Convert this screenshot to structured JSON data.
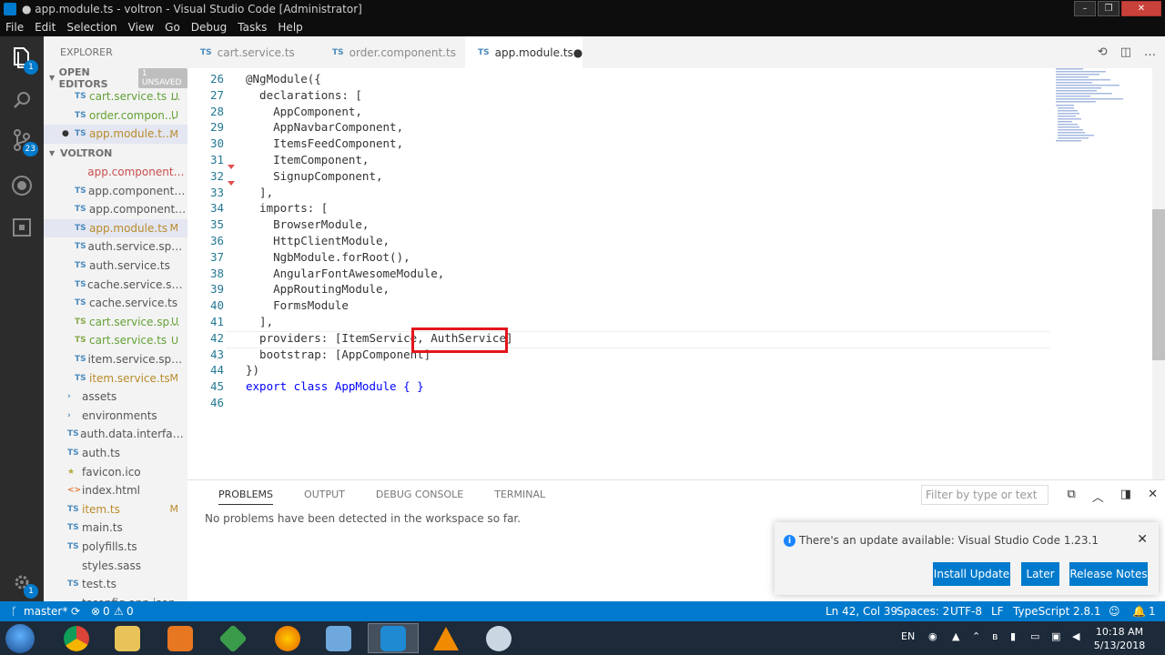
{
  "window": {
    "title": "● app.module.ts - voltron - Visual Studio Code [Administrator]"
  },
  "menu": [
    "File",
    "Edit",
    "Selection",
    "View",
    "Go",
    "Debug",
    "Tasks",
    "Help"
  ],
  "activity": {
    "scm_badge": "23",
    "explorer_badge": "1",
    "settings_badge": "1"
  },
  "sidebar": {
    "title": "EXPLORER",
    "open_editors": {
      "label": "OPEN EDITORS",
      "unsaved": "1 UNSAVED",
      "items": [
        {
          "icon": "TS",
          "name": "cart.service.ts ...",
          "status": "U"
        },
        {
          "icon": "TS",
          "name": "order.compon...",
          "status": "U"
        },
        {
          "icon": "TS",
          "name": "app.module.t...",
          "status": "M"
        }
      ]
    },
    "project": {
      "label": "VOLTRON",
      "items": [
        {
          "icon": "",
          "name": "app.component.sa...",
          "status": ""
        },
        {
          "icon": "TS",
          "name": "app.component.s...",
          "status": ""
        },
        {
          "icon": "TS",
          "name": "app.component.ts",
          "status": ""
        },
        {
          "icon": "TS",
          "name": "app.module.ts",
          "status": "M"
        },
        {
          "icon": "TS",
          "name": "auth.service.spec.ts",
          "status": ""
        },
        {
          "icon": "TS",
          "name": "auth.service.ts",
          "status": ""
        },
        {
          "icon": "TS",
          "name": "cache.service.spec...",
          "status": ""
        },
        {
          "icon": "TS",
          "name": "cache.service.ts",
          "status": ""
        },
        {
          "icon": "TS",
          "name": "cart.service.sp...",
          "status": "U"
        },
        {
          "icon": "TS",
          "name": "cart.service.ts",
          "status": "U"
        },
        {
          "icon": "TS",
          "name": "item.service.spec.ts",
          "status": ""
        },
        {
          "icon": "TS",
          "name": "item.service.ts",
          "status": "M"
        },
        {
          "icon": "›",
          "name": "assets",
          "status": ""
        },
        {
          "icon": "›",
          "name": "environments",
          "status": ""
        },
        {
          "icon": "TS",
          "name": "auth.data.interfaces...",
          "status": ""
        },
        {
          "icon": "TS",
          "name": "auth.ts",
          "status": ""
        },
        {
          "icon": "★",
          "name": "favicon.ico",
          "status": ""
        },
        {
          "icon": "<>",
          "name": "index.html",
          "status": ""
        },
        {
          "icon": "TS",
          "name": "item.ts",
          "status": "M"
        },
        {
          "icon": "TS",
          "name": "main.ts",
          "status": ""
        },
        {
          "icon": "TS",
          "name": "polyfills.ts",
          "status": ""
        },
        {
          "icon": "",
          "name": "styles.sass",
          "status": ""
        },
        {
          "icon": "TS",
          "name": "test.ts",
          "status": ""
        },
        {
          "icon": "",
          "name": "tsconfig.app.json",
          "status": ""
        }
      ]
    }
  },
  "tabs": [
    {
      "icon": "TS",
      "label": "cart.service.ts"
    },
    {
      "icon": "TS",
      "label": "order.component.ts"
    },
    {
      "icon": "TS",
      "label": "app.module.ts",
      "dirty": "●"
    }
  ],
  "editor": {
    "lines": [
      {
        "n": "26",
        "text": "@NgModule({"
      },
      {
        "n": "27",
        "text": "  declarations: ["
      },
      {
        "n": "28",
        "text": "    AppComponent,"
      },
      {
        "n": "29",
        "text": "    AppNavbarComponent,"
      },
      {
        "n": "30",
        "text": "    ItemsFeedComponent,"
      },
      {
        "n": "31",
        "text": "    ItemComponent,"
      },
      {
        "n": "32",
        "text": "    SignupComponent,"
      },
      {
        "n": "33",
        "text": "  ],"
      },
      {
        "n": "34",
        "text": "  imports: ["
      },
      {
        "n": "35",
        "text": "    BrowserModule,"
      },
      {
        "n": "36",
        "text": "    HttpClientModule,"
      },
      {
        "n": "37",
        "text": "    NgbModule.forRoot(),"
      },
      {
        "n": "38",
        "text": "    AngularFontAwesomeModule,"
      },
      {
        "n": "39",
        "text": "    AppRoutingModule,"
      },
      {
        "n": "40",
        "text": "    FormsModule"
      },
      {
        "n": "41",
        "text": "  ],"
      },
      {
        "n": "42",
        "text": "  providers: [ItemService, AuthService]"
      },
      {
        "n": "43",
        "text": "  bootstrap: [AppComponent]"
      },
      {
        "n": "44",
        "text": "})"
      },
      {
        "n": "45",
        "text": "export class AppModule { }"
      },
      {
        "n": "46",
        "text": ""
      }
    ]
  },
  "panel": {
    "tabs": [
      "PROBLEMS",
      "OUTPUT",
      "DEBUG CONSOLE",
      "TERMINAL"
    ],
    "filter_placeholder": "Filter by type or text",
    "message": "No problems have been detected in the workspace so far."
  },
  "notification": {
    "message": "There's an update available: Visual Studio Code 1.23.1",
    "install": "Install Update",
    "later": "Later",
    "notes": "Release Notes"
  },
  "statusbar": {
    "branch": "master*",
    "errors": "0",
    "warnings": "0",
    "position": "Ln 42, Col 39",
    "spaces": "Spaces: 2",
    "encoding": "UTF-8",
    "eol": "LF",
    "language": "TypeScript",
    "version": "2.8.1",
    "bell_count": "1"
  },
  "taskbar": {
    "lang": "EN",
    "time": "10:18 AM",
    "date": "5/13/2018"
  }
}
